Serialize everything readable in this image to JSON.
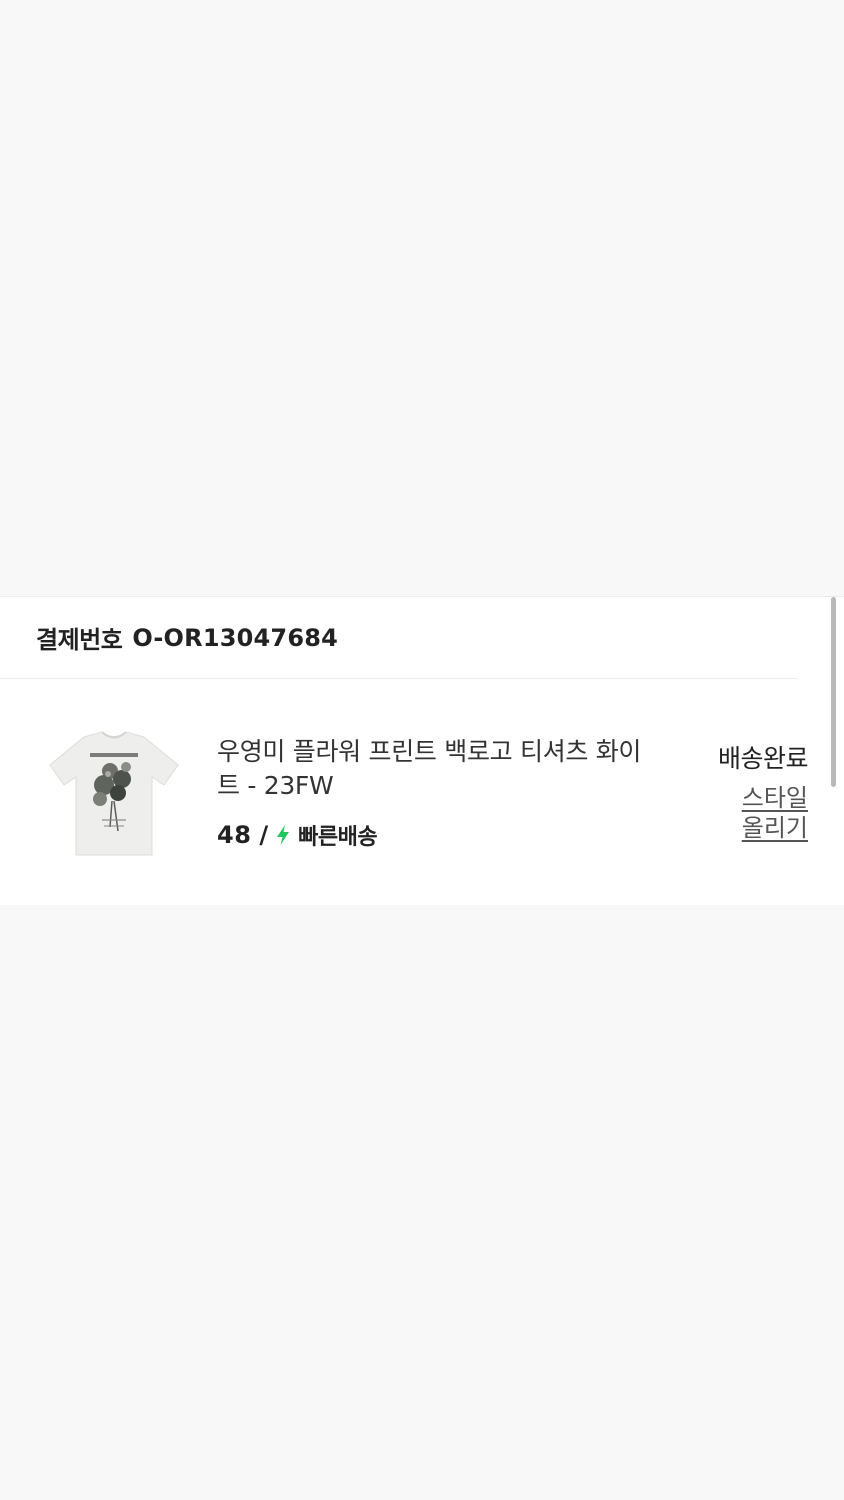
{
  "order": {
    "label": "결제번호",
    "number": "O-OR13047684"
  },
  "product": {
    "name": "우영미 플라워 프린트 백로고 티셔츠 화이트 - 23FW",
    "size": "48",
    "separator": "/",
    "delivery_type": "빠른배송",
    "delivery_icon": "lightning-bolt-icon",
    "delivery_icon_color": "#22c55e",
    "image": "white-tshirt-flower-print-thumbnail"
  },
  "status": {
    "label": "배송완료",
    "action_label": "스타일 올리기"
  },
  "colors": {
    "background": "#f8f8f8",
    "card": "#ffffff",
    "accent_green": "#22c55e"
  }
}
